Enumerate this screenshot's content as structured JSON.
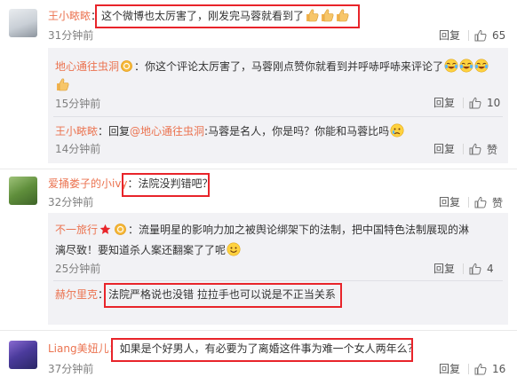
{
  "comments": [
    {
      "user": "王小畩畩",
      "text": "：这个微博也太厉害了，刚发完马蓉就看到了",
      "time": "31分钟前",
      "reply_label": "回复",
      "likes": "65",
      "replies": [
        {
          "user": "地心通往虫洞",
          "text_line1": "：你这个评论太厉害了，马蓉刚点赞你就看到并呼哧呼哧来评论了",
          "time": "15分钟前",
          "reply_label": "回复",
          "likes": "10"
        },
        {
          "user": "王小畩畩",
          "prefix": "：回复",
          "mention": "@地心通往虫洞",
          "text": ":马蓉是名人，你是吗？你能和马蓉比吗",
          "time": "14分钟前",
          "reply_label": "回复",
          "likes": "赞"
        }
      ]
    },
    {
      "user": "爱捅娄子的小ivy",
      "text": "：法院没判错吧？",
      "time": "32分钟前",
      "reply_label": "回复",
      "likes": "赞",
      "replies": [
        {
          "user": "不一旅行",
          "text_line1": "：流量明星的影响力加之被舆论绑架下的法制，把中国特色法制展现的淋",
          "text_line2": "漓尽致！要知道杀人案还翻案了了呢",
          "time": "25分钟前",
          "reply_label": "回复",
          "likes": "4"
        },
        {
          "user": "赫尔里克",
          "text": "：法院严格说也没错 拉拉手也可以说是不正当关系",
          "time": "",
          "reply_label": "",
          "likes": ""
        }
      ]
    },
    {
      "user": "Liang美妞儿",
      "text": "：如果是个好男人，有必要为了离婚这件事为难一个女人两年么？",
      "time": "37分钟前",
      "reply_label": "回复",
      "likes": "16"
    }
  ],
  "colors": {
    "username": "#eb7350",
    "highlight_border": "#e8242a",
    "reply_bg": "#f2f2f5",
    "meta_gray": "#808080"
  },
  "icons": [
    "thumb-up-icon",
    "vip-badge-icon",
    "star-icon",
    "thumbs-up-emoji",
    "laugh-cry-emoji",
    "smile-emoji",
    "sad-emoji"
  ]
}
